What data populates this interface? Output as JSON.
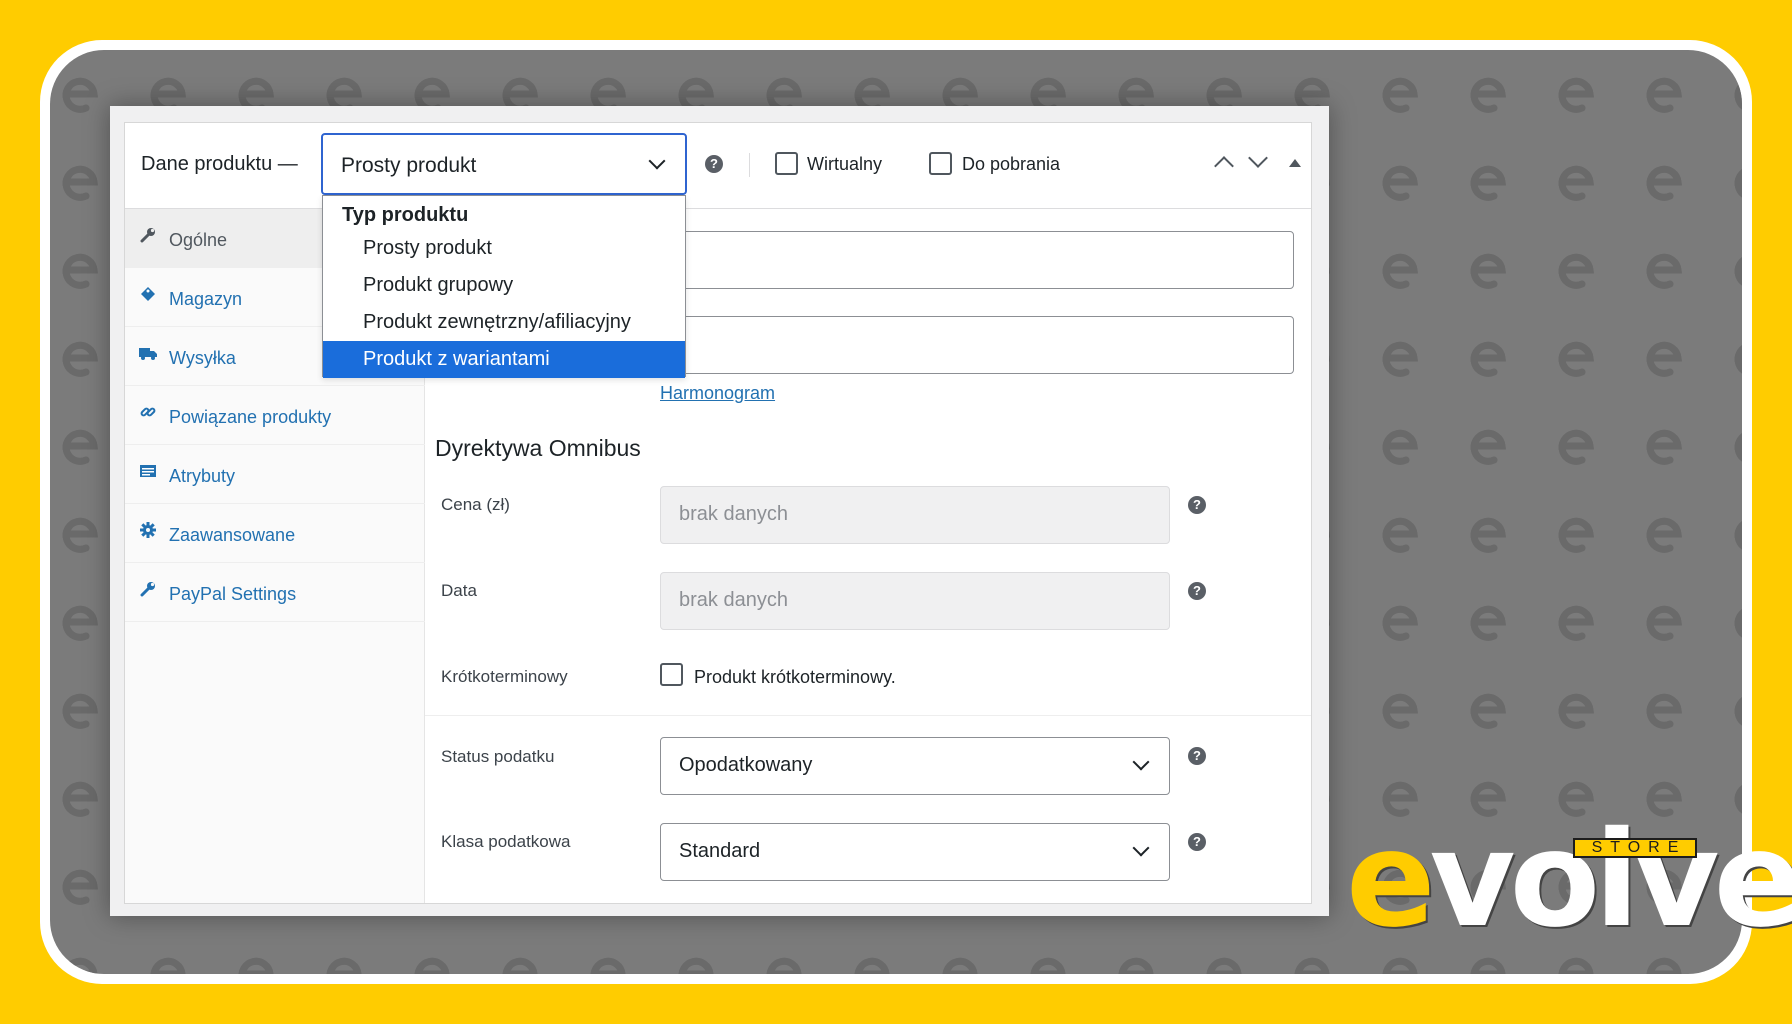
{
  "header": {
    "title": "Dane produktu —",
    "product_type_selected": "Prosty produkt",
    "virtual_label": "Wirtualny",
    "downloadable_label": "Do pobrania"
  },
  "dropdown": {
    "group_label": "Typ produktu",
    "options": [
      "Prosty produkt",
      "Produkt grupowy",
      "Produkt zewnętrzny/afiliacyjny",
      "Produkt z wariantami"
    ],
    "highlighted_index": 3
  },
  "sidebar": {
    "items": [
      {
        "label": "Ogólne",
        "icon": "wrench-icon",
        "active": true
      },
      {
        "label": "Magazyn",
        "icon": "tag-icon",
        "active": false
      },
      {
        "label": "Wysyłka",
        "icon": "truck-icon",
        "active": false
      },
      {
        "label": "Powiązane produkty",
        "icon": "link-icon",
        "active": false
      },
      {
        "label": "Atrybuty",
        "icon": "list-icon",
        "active": false
      },
      {
        "label": "Zaawansowane",
        "icon": "gear-icon",
        "active": false
      },
      {
        "label": "PayPal Settings",
        "icon": "wrench-icon",
        "active": false
      }
    ]
  },
  "general": {
    "schedule_link": "Harmonogram",
    "omnibus_title": "Dyrektywa Omnibus",
    "price_label": "Cena (zł)",
    "price_placeholder": "brak danych",
    "date_label": "Data",
    "date_placeholder": "brak danych",
    "short_term_label": "Krótkoterminowy",
    "short_term_checkbox_label": "Produkt krótkoterminowy.",
    "tax_status_label": "Status podatku",
    "tax_status_value": "Opodatkowany",
    "tax_class_label": "Klasa podatkowa",
    "tax_class_value": "Standard"
  },
  "logo": {
    "store_text": "STORE",
    "brand_e": "e",
    "brand_rest": "volve"
  },
  "colors": {
    "background": "#FFCC00",
    "accent": "#2271b1",
    "highlight": "#1a6ddb"
  }
}
